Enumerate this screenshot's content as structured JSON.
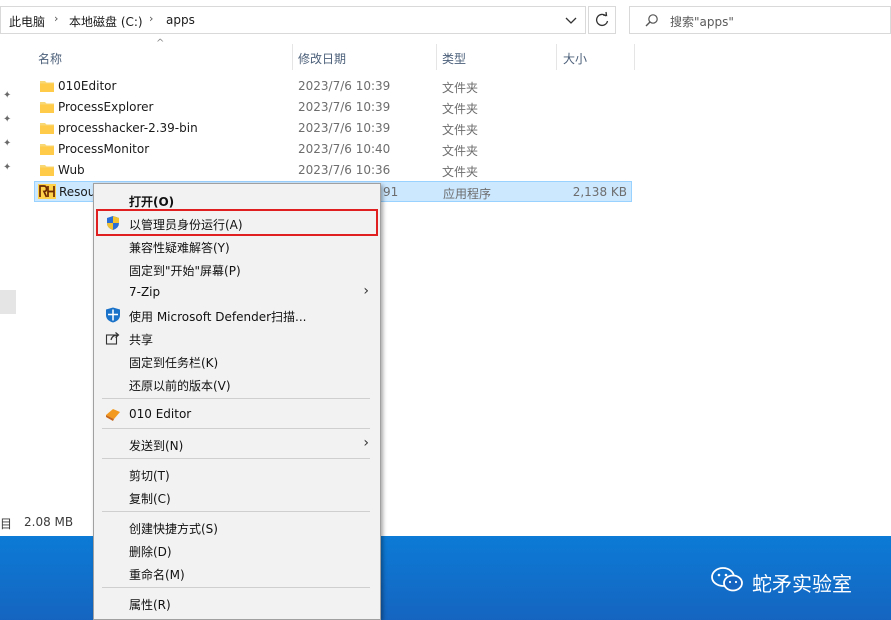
{
  "address": {
    "crumbs": [
      "此电脑",
      "本地磁盘 (C:)",
      "apps"
    ],
    "search_placeholder": "搜索\"apps\""
  },
  "columns": [
    "名称",
    "修改日期",
    "类型",
    "大小"
  ],
  "pins": [
    "pin-icon",
    "pin-icon",
    "pin-icon",
    "pin-icon"
  ],
  "files": [
    {
      "name": "010Editor",
      "date": "2023/7/6 10:39",
      "type": "文件夹",
      "size": ""
    },
    {
      "name": "ProcessExplorer",
      "date": "2023/7/6 10:39",
      "type": "文件夹",
      "size": ""
    },
    {
      "name": "processhacker-2.39-bin",
      "date": "2023/7/6 10:39",
      "type": "文件夹",
      "size": ""
    },
    {
      "name": "ProcessMonitor",
      "date": "2023/7/6 10:40",
      "type": "文件夹",
      "size": ""
    },
    {
      "name": "Wub",
      "date": "2023/7/6 10:36",
      "type": "文件夹",
      "size": ""
    },
    {
      "name": "Resou",
      "date": "91",
      "type": "应用程序",
      "size": "2,138 KB",
      "selected": true
    }
  ],
  "status": {
    "left": "项目",
    "size": "2.08 MB"
  },
  "watermark": "蛇矛实验室",
  "menu": {
    "open": "打开(O)",
    "run_as_admin": "以管理员身份运行(A)",
    "compat": "兼容性疑难解答(Y)",
    "pin_start": "固定到\"开始\"屏幕(P)",
    "zip": "7-Zip",
    "defender": "使用 Microsoft Defender扫描...",
    "share": "共享",
    "pin_taskbar": "固定到任务栏(K)",
    "restore": "还原以前的版本(V)",
    "editor": "010 Editor",
    "send_to": "发送到(N)",
    "cut": "剪切(T)",
    "copy": "复制(C)",
    "shortcut": "创建快捷方式(S)",
    "delete": "删除(D)",
    "rename": "重命名(M)",
    "properties": "属性(R)"
  },
  "colors": {
    "accent": "#0078d7",
    "highlight_box": "#e02020",
    "selection": "#cce8ff",
    "taskbar": "#0c7bd6"
  }
}
